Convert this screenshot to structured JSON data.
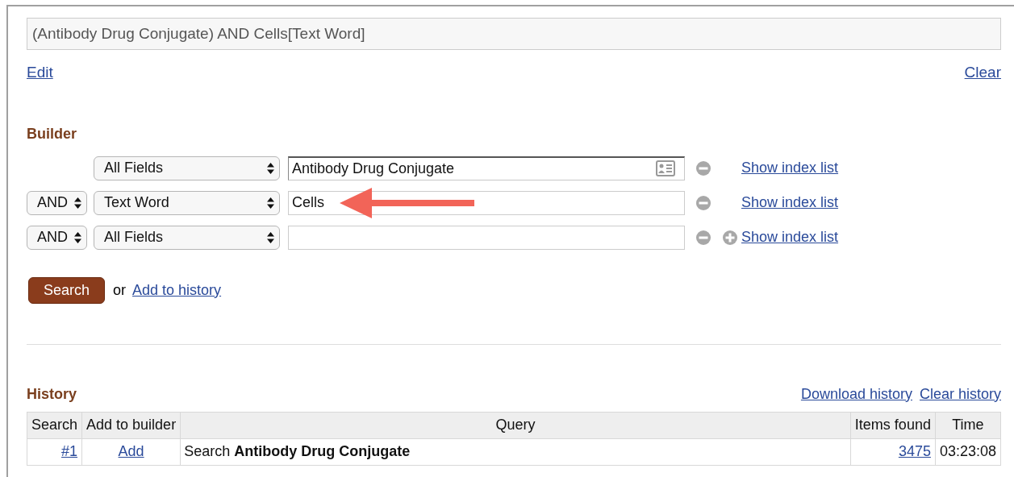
{
  "query_box": {
    "value": "(Antibody Drug Conjugate) AND Cells[Text Word]"
  },
  "links": {
    "edit": "Edit",
    "clear": "Clear"
  },
  "builder": {
    "title": "Builder",
    "rows": [
      {
        "operator": null,
        "field": "All Fields",
        "value": "Antibody Drug Conjugate",
        "focused": true,
        "can_add": false,
        "annotated": false,
        "show_index": "Show index list"
      },
      {
        "operator": "AND",
        "field": "Text Word",
        "value": "Cells",
        "focused": false,
        "can_add": false,
        "annotated": true,
        "show_index": "Show index list"
      },
      {
        "operator": "AND",
        "field": "All Fields",
        "value": "",
        "focused": false,
        "can_add": true,
        "annotated": false,
        "show_index": "Show index list"
      }
    ],
    "search_button": "Search",
    "or_text": "or",
    "add_to_history": "Add to history"
  },
  "history": {
    "title": "History",
    "download": "Download history",
    "clear": "Clear history",
    "columns": [
      "Search",
      "Add to builder",
      "Query",
      "Items found",
      "Time"
    ],
    "rows": [
      {
        "search": "#1",
        "add": "Add",
        "query": "Search **Antibody Drug Conjugate**",
        "items_found": "3475",
        "time": "03:23:08"
      }
    ]
  }
}
